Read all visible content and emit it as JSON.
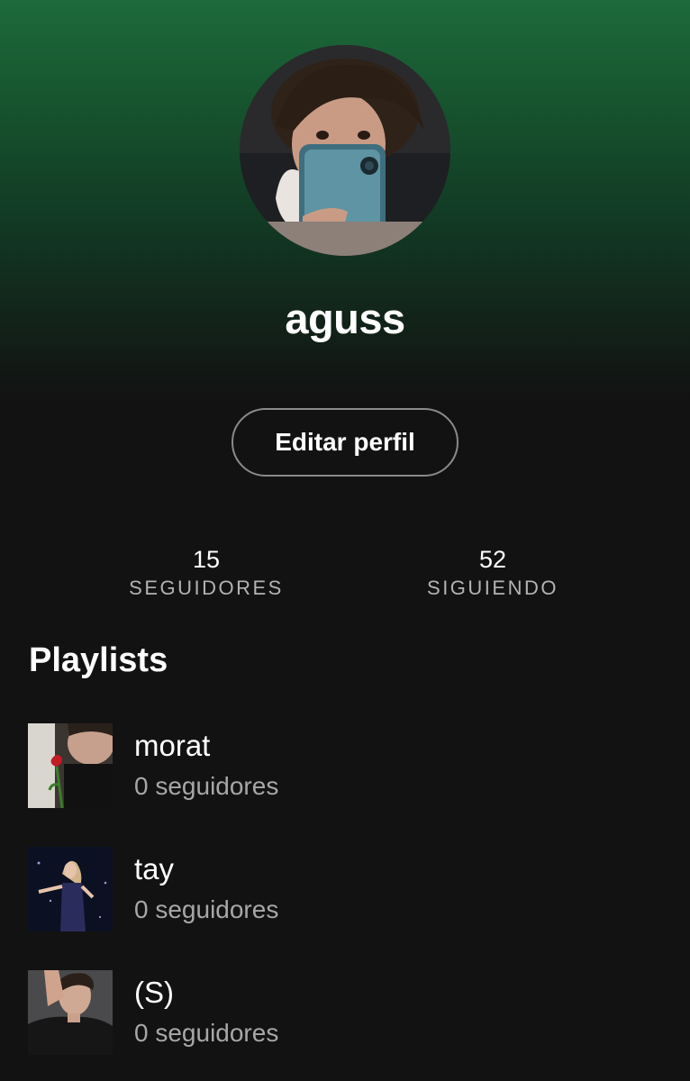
{
  "profile": {
    "username": "aguss",
    "edit_label": "Editar perfil",
    "avatar_icon": "profile-photo",
    "accent_color": "#1d6a3c",
    "background_color": "#121212"
  },
  "stats": {
    "followers": {
      "count": "15",
      "label": "SEGUIDORES"
    },
    "following": {
      "count": "52",
      "label": "SIGUIENDO"
    }
  },
  "playlists": {
    "title": "Playlists",
    "items": [
      {
        "name": "morat",
        "followers": "0 seguidores"
      },
      {
        "name": "tay",
        "followers": "0 seguidores"
      },
      {
        "name": "(S)",
        "followers": "0 seguidores"
      }
    ]
  }
}
